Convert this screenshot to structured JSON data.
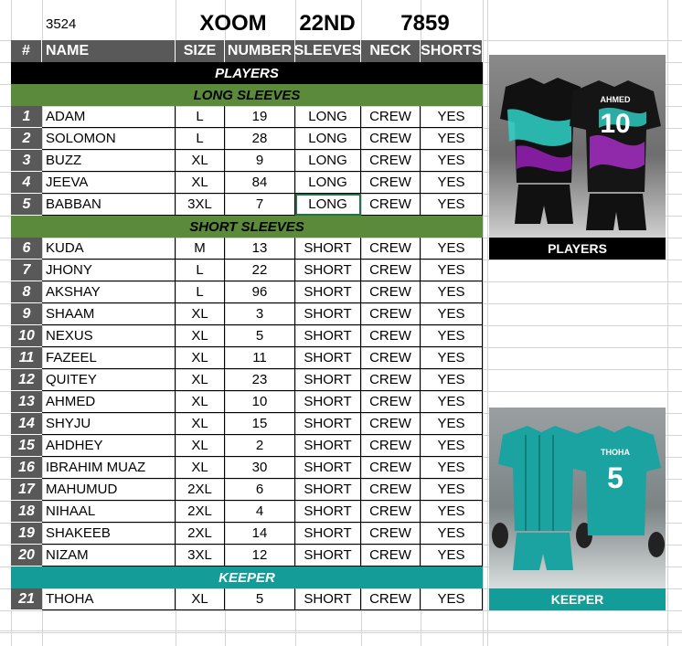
{
  "top": {
    "id": "3524",
    "brand": "XOOM",
    "date": "22ND",
    "code": "7859"
  },
  "headers": [
    "#",
    "NAME",
    "SIZE",
    "NUMBER",
    "SLEEVES",
    "NECK",
    "SHORTS"
  ],
  "sections": {
    "players": "PLAYERS",
    "long": "LONG SLEEVES",
    "short": "SHORT SLEEVES",
    "keeper": "KEEPER"
  },
  "rows": [
    {
      "n": "1",
      "name": "ADAM",
      "size": "L",
      "number": "19",
      "sleeves": "LONG",
      "neck": "CREW",
      "shorts": "YES"
    },
    {
      "n": "2",
      "name": "SOLOMON",
      "size": "L",
      "number": "28",
      "sleeves": "LONG",
      "neck": "CREW",
      "shorts": "YES"
    },
    {
      "n": "3",
      "name": "BUZZ",
      "size": "XL",
      "number": "9",
      "sleeves": "LONG",
      "neck": "CREW",
      "shorts": "YES"
    },
    {
      "n": "4",
      "name": "JEEVA",
      "size": "XL",
      "number": "84",
      "sleeves": "LONG",
      "neck": "CREW",
      "shorts": "YES"
    },
    {
      "n": "5",
      "name": "BABBAN",
      "size": "3XL",
      "number": "7",
      "sleeves": "LONG",
      "neck": "CREW",
      "shorts": "YES"
    },
    {
      "n": "6",
      "name": "KUDA",
      "size": "M",
      "number": "13",
      "sleeves": "SHORT",
      "neck": "CREW",
      "shorts": "YES"
    },
    {
      "n": "7",
      "name": "JHONY",
      "size": "L",
      "number": "22",
      "sleeves": "SHORT",
      "neck": "CREW",
      "shorts": "YES"
    },
    {
      "n": "8",
      "name": "AKSHAY",
      "size": "L",
      "number": "96",
      "sleeves": "SHORT",
      "neck": "CREW",
      "shorts": "YES"
    },
    {
      "n": "9",
      "name": "SHAAM",
      "size": "XL",
      "number": "3",
      "sleeves": "SHORT",
      "neck": "CREW",
      "shorts": "YES"
    },
    {
      "n": "10",
      "name": "NEXUS",
      "size": "XL",
      "number": "5",
      "sleeves": "SHORT",
      "neck": "CREW",
      "shorts": "YES"
    },
    {
      "n": "11",
      "name": "FAZEEL",
      "size": "XL",
      "number": "11",
      "sleeves": "SHORT",
      "neck": "CREW",
      "shorts": "YES"
    },
    {
      "n": "12",
      "name": "QUITEY",
      "size": "XL",
      "number": "23",
      "sleeves": "SHORT",
      "neck": "CREW",
      "shorts": "YES"
    },
    {
      "n": "13",
      "name": "AHMED",
      "size": "XL",
      "number": "10",
      "sleeves": "SHORT",
      "neck": "CREW",
      "shorts": "YES"
    },
    {
      "n": "14",
      "name": "SHYJU",
      "size": "XL",
      "number": "15",
      "sleeves": "SHORT",
      "neck": "CREW",
      "shorts": "YES"
    },
    {
      "n": "15",
      "name": "AHDHEY",
      "size": "XL",
      "number": "2",
      "sleeves": "SHORT",
      "neck": "CREW",
      "shorts": "YES"
    },
    {
      "n": "16",
      "name": "IBRAHIM MUAZ",
      "size": "XL",
      "number": "30",
      "sleeves": "SHORT",
      "neck": "CREW",
      "shorts": "YES"
    },
    {
      "n": "17",
      "name": "MAHUMUD",
      "size": "2XL",
      "number": "6",
      "sleeves": "SHORT",
      "neck": "CREW",
      "shorts": "YES"
    },
    {
      "n": "18",
      "name": "NIHAAL",
      "size": "2XL",
      "number": "4",
      "sleeves": "SHORT",
      "neck": "CREW",
      "shorts": "YES"
    },
    {
      "n": "19",
      "name": "SHAKEEB",
      "size": "2XL",
      "number": "14",
      "sleeves": "SHORT",
      "neck": "CREW",
      "shorts": "YES"
    },
    {
      "n": "20",
      "name": "NIZAM",
      "size": "3XL",
      "number": "12",
      "sleeves": "SHORT",
      "neck": "CREW",
      "shorts": "YES"
    },
    {
      "n": "21",
      "name": "THOHA",
      "size": "XL",
      "number": "5",
      "sleeves": "SHORT",
      "neck": "CREW",
      "shorts": "YES"
    }
  ],
  "images": {
    "players": {
      "caption": "PLAYERS",
      "jersey_name": "AHMED",
      "jersey_number": "10"
    },
    "keeper": {
      "caption": "KEEPER",
      "jersey_name": "THOHA",
      "jersey_number": "5"
    }
  },
  "colors": {
    "header": "#595959",
    "long_band": "#5b8a3a",
    "keeper_band": "#149c98",
    "players_band": "#000000"
  }
}
